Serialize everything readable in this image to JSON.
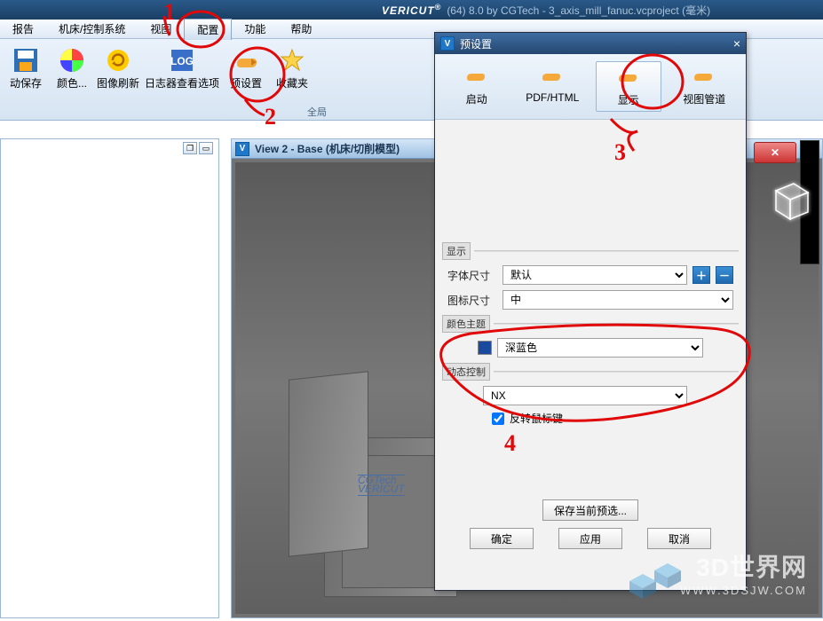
{
  "app": {
    "name": "VERICUT",
    "suffix": "(64) 8.0 by CGTech - 3_axis_mill_fanuc.vcproject (毫米)"
  },
  "menus": {
    "report": "报告",
    "machine": "机床/控制系统",
    "view": "视图",
    "config": "配置",
    "function": "功能",
    "help": "帮助"
  },
  "ribbon": {
    "autosave": "动保存",
    "color": "颜色...",
    "imgrefresh": "图像刷新",
    "logview": "日志器查看选项",
    "preset": "预设置",
    "favorites": "收藏夹",
    "group_label": "全局"
  },
  "view2": {
    "title": "View 2 - Base (机床/切削模型)"
  },
  "scene_logo": {
    "l1": "CGTech",
    "l2": "VERICUT"
  },
  "dialog": {
    "title": "预设置",
    "tabs": {
      "start": "启动",
      "pdf": "PDF/HTML",
      "display": "显示",
      "pipeline": "视图管道"
    },
    "sec_display": "显示",
    "font_label": "字体尺寸",
    "font_value": "默认",
    "icon_label": "图标尺寸",
    "icon_value": "中",
    "sec_theme": "颜色主题",
    "theme_value": "深蓝色",
    "sec_dyn": "动态控制",
    "dyn_value": "NX",
    "invert_label": "反转鼠标键",
    "save_current": "保存当前预选...",
    "ok": "确定",
    "apply": "应用",
    "cancel": "取消"
  },
  "anno": {
    "n1": "1",
    "n2": "2",
    "n3": "3",
    "n4": "4"
  },
  "wm": {
    "big": "3D世界网",
    "url": "WWW.3DSJW.COM"
  }
}
